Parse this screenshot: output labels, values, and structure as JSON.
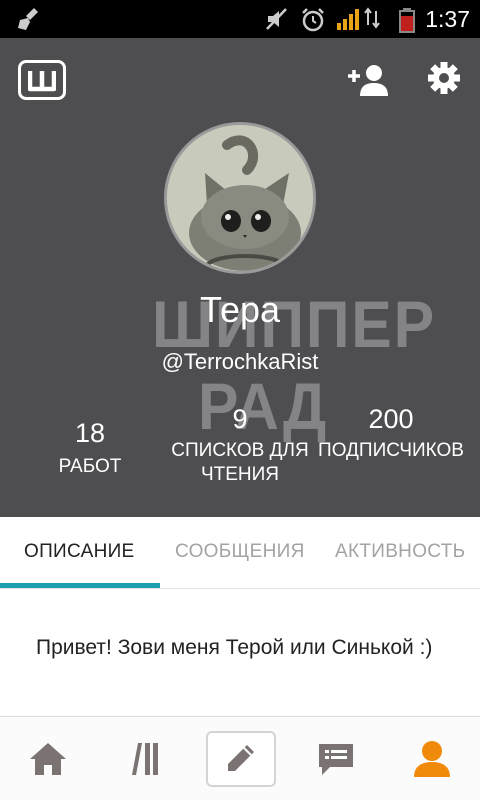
{
  "status_bar": {
    "time": "1:37",
    "icons": [
      "broom-icon",
      "mute-icon",
      "alarm-icon",
      "signal-icon",
      "data-arrows-icon",
      "battery-icon"
    ]
  },
  "header": {
    "logo_letter": "Ш",
    "follow_icon": "add-person-icon",
    "settings_icon": "gear-icon"
  },
  "profile": {
    "name": "Тера",
    "username": "@TerrochkaRist",
    "watermark_line1": "ШИППЕР",
    "watermark_line2": "РАД",
    "stats": [
      {
        "value": "18",
        "label": "РАБОТ"
      },
      {
        "value": "9",
        "label": "СПИСКОВ ДЛЯ ЧТЕНИЯ"
      },
      {
        "value": "200",
        "label": "ПОДПИСЧИКОВ"
      }
    ]
  },
  "tabs": [
    {
      "label": "ОПИСАНИЕ",
      "active": true
    },
    {
      "label": "СООБЩЕНИЯ",
      "active": false
    },
    {
      "label": "АКТИВНОСТЬ",
      "active": false
    }
  ],
  "description": {
    "text": "Привет! Зови меня Терой или Синькой :)"
  },
  "bottom_nav": [
    {
      "icon": "home-icon",
      "active": false
    },
    {
      "icon": "library-icon",
      "active": false
    },
    {
      "icon": "pencil-icon",
      "active": false
    },
    {
      "icon": "messages-icon",
      "active": false
    },
    {
      "icon": "profile-icon",
      "active": true
    }
  ],
  "colors": {
    "header_bg": "#4e4d50",
    "accent": "#1e9eb1",
    "active_nav": "#f08a0b",
    "inactive_nav": "#7a7371"
  }
}
